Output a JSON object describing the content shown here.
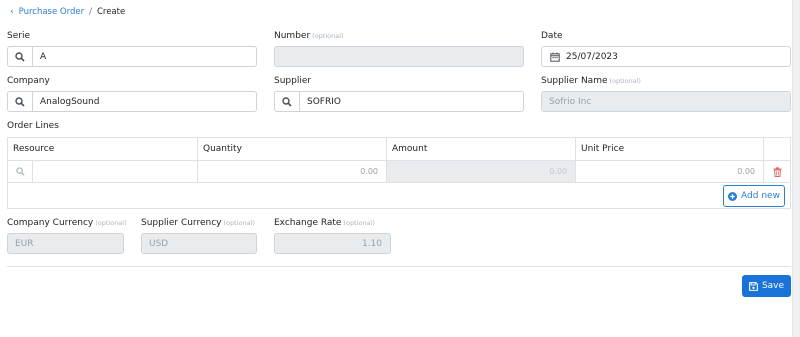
{
  "breadcrumb": {
    "parent": "Purchase Order",
    "separator": "/",
    "current": "Create"
  },
  "form": {
    "serie": {
      "label": "Serie",
      "value": "A"
    },
    "number": {
      "label": "Number",
      "optional": "(optional)",
      "value": ""
    },
    "date": {
      "label": "Date",
      "value": "25/07/2023"
    },
    "company": {
      "label": "Company",
      "value": "AnalogSound"
    },
    "supplier": {
      "label": "Supplier",
      "value": "SOFRIO"
    },
    "supplier_name": {
      "label": "Supplier Name",
      "optional": "(optional)",
      "value": "Sofrio Inc"
    }
  },
  "order_lines": {
    "title": "Order Lines",
    "columns": [
      "Resource",
      "Quantity",
      "Amount",
      "Unit Price"
    ],
    "rows": [
      {
        "resource": "",
        "quantity": "0.00",
        "amount": "0.00",
        "unit_price": "0.00"
      }
    ],
    "add_label": "Add new"
  },
  "currency": {
    "company_currency": {
      "label": "Company Currency",
      "optional": "(optional)",
      "value": "EUR"
    },
    "supplier_currency": {
      "label": "Supplier Currency",
      "optional": "(optional)",
      "value": "USD"
    },
    "exchange_rate": {
      "label": "Exchange Rate",
      "optional": "(optional)",
      "value": "1.10"
    }
  },
  "actions": {
    "save_label": "Save"
  },
  "colors": {
    "accent": "#1a73d9",
    "link": "#2b7fd3",
    "disabled_bg": "#e9ecef",
    "danger": "#e06c6c"
  }
}
